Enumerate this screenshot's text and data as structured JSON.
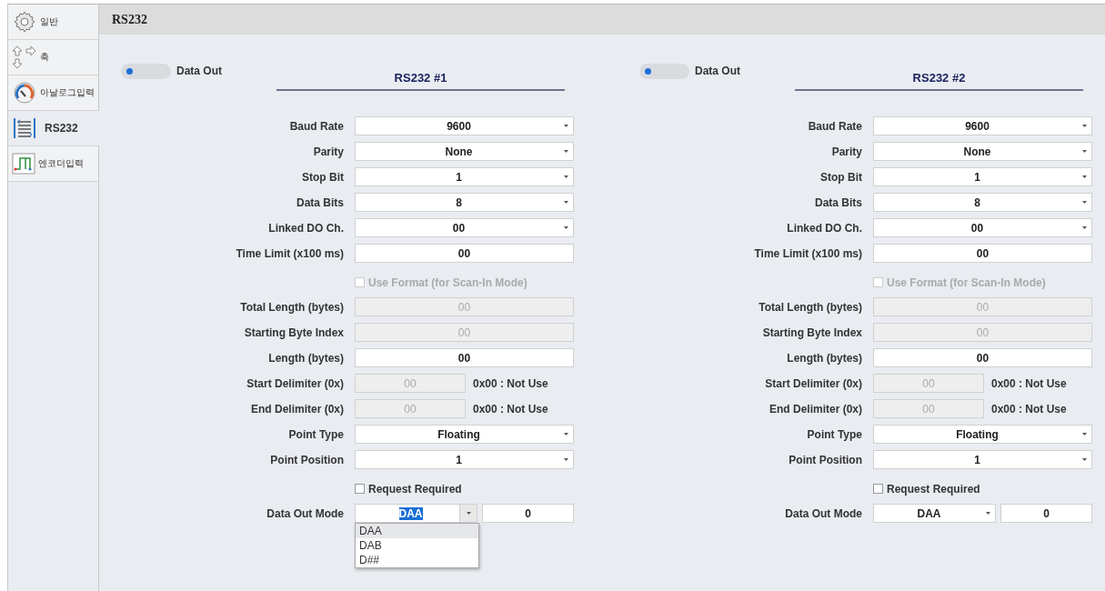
{
  "sidebar": {
    "items": [
      {
        "label": "일반",
        "selected": false
      },
      {
        "label": "축",
        "selected": false
      },
      {
        "label": "아날로그입력",
        "selected": false
      },
      {
        "label": "RS232",
        "selected": true
      },
      {
        "label": "엔코더입력",
        "selected": false
      }
    ]
  },
  "header": {
    "title": "RS232"
  },
  "panels": [
    {
      "title": "RS232 #1",
      "data_out": {
        "label": "Data Out",
        "on": true
      },
      "rows": [
        {
          "kind": "select",
          "label": "Baud Rate",
          "value": "9600"
        },
        {
          "kind": "select",
          "label": "Parity",
          "value": "None"
        },
        {
          "kind": "select",
          "label": "Stop Bit",
          "value": "1"
        },
        {
          "kind": "select",
          "label": "Data Bits",
          "value": "8"
        },
        {
          "kind": "select",
          "label": "Linked DO Ch.",
          "value": "00"
        },
        {
          "kind": "input",
          "label": "Time Limit (x100 ms)",
          "value": "00",
          "disabled": false
        },
        {
          "kind": "check",
          "label": "Use Format (for Scan-In Mode)",
          "checked": false,
          "disabled": true
        },
        {
          "kind": "input",
          "label": "Total Length (bytes)",
          "value": "00",
          "disabled": true
        },
        {
          "kind": "input",
          "label": "Starting Byte Index",
          "value": "00",
          "disabled": true
        },
        {
          "kind": "input",
          "label": "Length (bytes)",
          "value": "00",
          "disabled": false
        },
        {
          "kind": "delimiter",
          "label": "Start Delimiter (0x)",
          "value": "00",
          "note": "0x00 : Not Use",
          "disabled": true
        },
        {
          "kind": "delimiter",
          "label": "End Delimiter (0x)",
          "value": "00",
          "note": "0x00 : Not Use",
          "disabled": true
        },
        {
          "kind": "select",
          "label": "Point Type",
          "value": "Floating"
        },
        {
          "kind": "select",
          "label": "Point Position",
          "value": "1"
        },
        {
          "kind": "check",
          "label": "Request Required",
          "checked": false,
          "disabled": false
        },
        {
          "kind": "mode",
          "label": "Data Out Mode",
          "value": "DAA",
          "number": "0",
          "expanded": true,
          "options": [
            {
              "label": "DAA",
              "selected": true
            },
            {
              "label": "DAB",
              "selected": false
            },
            {
              "label": "D##",
              "selected": false
            }
          ]
        }
      ]
    },
    {
      "title": "RS232 #2",
      "data_out": {
        "label": "Data Out",
        "on": true
      },
      "rows": [
        {
          "kind": "select",
          "label": "Baud Rate",
          "value": "9600"
        },
        {
          "kind": "select",
          "label": "Parity",
          "value": "None"
        },
        {
          "kind": "select",
          "label": "Stop Bit",
          "value": "1"
        },
        {
          "kind": "select",
          "label": "Data Bits",
          "value": "8"
        },
        {
          "kind": "select",
          "label": "Linked DO Ch.",
          "value": "00"
        },
        {
          "kind": "input",
          "label": "Time Limit (x100 ms)",
          "value": "00",
          "disabled": false
        },
        {
          "kind": "check",
          "label": "Use Format (for Scan-In Mode)",
          "checked": false,
          "disabled": true
        },
        {
          "kind": "input",
          "label": "Total Length (bytes)",
          "value": "00",
          "disabled": true
        },
        {
          "kind": "input",
          "label": "Starting Byte Index",
          "value": "00",
          "disabled": true
        },
        {
          "kind": "input",
          "label": "Length (bytes)",
          "value": "00",
          "disabled": false
        },
        {
          "kind": "delimiter",
          "label": "Start Delimiter (0x)",
          "value": "00",
          "note": "0x00 : Not Use",
          "disabled": true
        },
        {
          "kind": "delimiter",
          "label": "End Delimiter (0x)",
          "value": "00",
          "note": "0x00 : Not Use",
          "disabled": true
        },
        {
          "kind": "select",
          "label": "Point Type",
          "value": "Floating"
        },
        {
          "kind": "select",
          "label": "Point Position",
          "value": "1"
        },
        {
          "kind": "check",
          "label": "Request Required",
          "checked": false,
          "disabled": false
        },
        {
          "kind": "mode",
          "label": "Data Out Mode",
          "value": "DAA",
          "number": "0",
          "expanded": false
        }
      ]
    }
  ]
}
